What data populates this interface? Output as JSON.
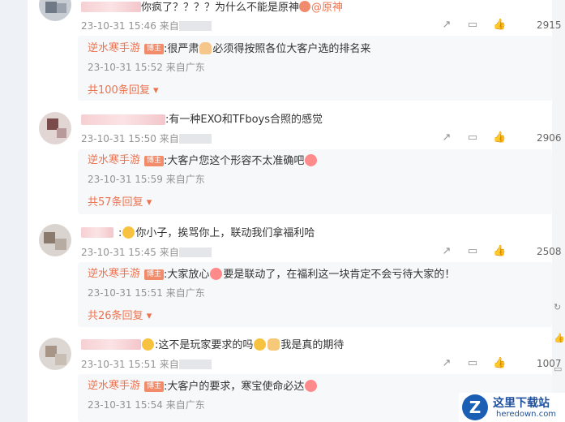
{
  "comments": [
    {
      "text_prefix": "你疯了？？？？为什么不能是原神",
      "mention": "@原神",
      "timestamp": "23-10-31 15:46",
      "from_label": "来自",
      "like_count": "2915",
      "reply": {
        "author": "逆水寒手游",
        "badge": "博主",
        "text_a": ":很严肃",
        "text_b": "必须得按照各位大客户选的排名来",
        "timestamp": "23-10-31 15:52",
        "location": "来自广东",
        "more": "共100条回复"
      }
    },
    {
      "text": ":有一种EXO和TFboys合照的感觉",
      "timestamp": "23-10-31 15:50",
      "from_label": "来自",
      "like_count": "2906",
      "reply": {
        "author": "逆水寒手游",
        "badge": "博主",
        "text_a": ":大客户您这个形容不太准确吧",
        "timestamp": "23-10-31 15:59",
        "location": "来自广东",
        "more": "共57条回复"
      }
    },
    {
      "text": "你小子，挨骂你上，联动我们拿福利哈",
      "timestamp": "23-10-31 15:45",
      "from_label": "来自",
      "like_count": "2508",
      "reply": {
        "author": "逆水寒手游",
        "badge": "博主",
        "text_a": ":大家放心",
        "text_b": "要是联动了，在福利这一块肯定不会亏待大家的！",
        "timestamp": "23-10-31 15:51",
        "location": "来自广东",
        "more": "共26条回复"
      }
    },
    {
      "text_a": ":这不是玩家要求的吗",
      "text_b": "我是真的期待",
      "timestamp": "23-10-31 15:51",
      "from_label": "来自",
      "like_count": "1007",
      "reply": {
        "author": "逆水寒手游",
        "badge": "博主",
        "text_a": ":大客户的要求，寒宝使命必达",
        "timestamp": "23-10-31 15:54",
        "location": "来自广东"
      }
    }
  ],
  "watermark": {
    "logo": "Z",
    "title": "这里下载站",
    "url": "heredown.com"
  },
  "icons": [
    "share-icon",
    "comment-icon",
    "like-icon",
    "refresh-icon",
    "thumb-icon",
    "comment-side-icon"
  ],
  "colors": {
    "link": "#eb7350",
    "badge": "#f28b6a",
    "meta": "#939393",
    "reply_bg": "#f7f8fa"
  }
}
